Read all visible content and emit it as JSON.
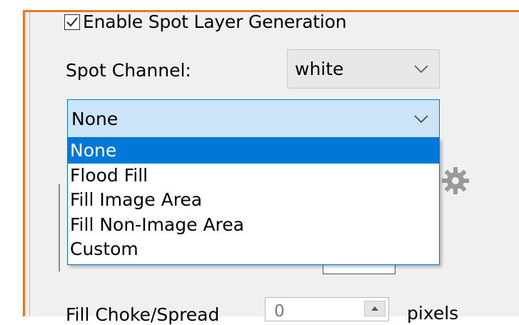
{
  "spot_layer": {
    "enable_label": "Enable Spot Layer Generation",
    "enable_checked": true
  },
  "spot_channel": {
    "label": "Spot Channel:",
    "value": "white"
  },
  "fill_type": {
    "value": "None",
    "options": [
      "None",
      "Flood Fill",
      "Fill Image Area",
      "Fill Non-Image Area",
      "Custom"
    ],
    "selected_option": "None"
  },
  "fill_choke_spread": {
    "label": "Fill Choke/Spread",
    "value": "0",
    "unit": "pixels"
  },
  "icons": {
    "check": "checkmark-icon",
    "chevron": "chevron-down-icon",
    "settings": "gear-icon",
    "spin_up": "arrow-up-icon"
  },
  "colors": {
    "accent_border": "#e87722",
    "selection": "#0078d7",
    "combo_focus_bg": "#cce4f7"
  }
}
